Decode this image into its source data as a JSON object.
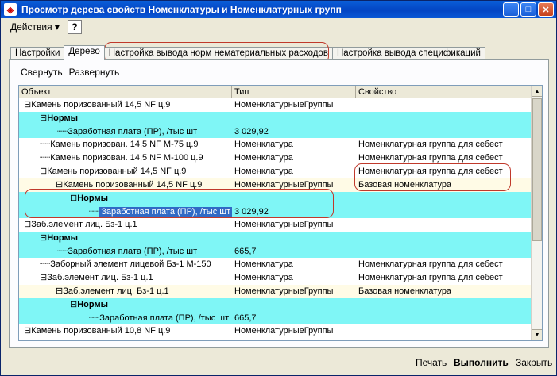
{
  "window": {
    "title": "Просмотр дерева свойств Номенклатуры и Номенклатурных групп",
    "icon": "app-icon"
  },
  "menubar": {
    "actions_label": "Действия ▾",
    "help_label": "?"
  },
  "tabs": [
    "Настройки",
    "Дерево",
    "Настройка вывода норм нематериальных расходов",
    "Настройка вывода спецификаций"
  ],
  "toolbar": {
    "collapse_label": "Свернуть",
    "expand_label": "Развернуть"
  },
  "table": {
    "columns": [
      "Объект",
      "Тип",
      "Свойство"
    ],
    "rows": [
      {
        "object": "Камень поризованный 14,5  NF ц.9",
        "type": "НоменклатурныеГруппы",
        "property": ""
      },
      {
        "object": "Нормы",
        "type": "",
        "property": ""
      },
      {
        "object": "Заработная плата (ПР), /тыс шт",
        "type": "3 029,92",
        "property": ""
      },
      {
        "object": "Камень поризован. 14,5 NF М-75 ц.9",
        "type": "Номенклатура",
        "property": "Номенклатурная группа для себест"
      },
      {
        "object": "Камень поризован. 14,5 NF М-100 ц.9",
        "type": "Номенклатура",
        "property": "Номенклатурная группа для себест"
      },
      {
        "object": "Камень поризованный 14,5  NF ц.9",
        "type": "Номенклатура",
        "property": "Номенклатурная группа для себест"
      },
      {
        "object": "Камень поризованный 14,5  NF ц.9",
        "type": "НоменклатурныеГруппы",
        "property": "Базовая номенклатура"
      },
      {
        "object": "Нормы",
        "type": "",
        "property": ""
      },
      {
        "object": "Заработная плата (ПР), /тыс шт",
        "type": "3 029,92",
        "property": ""
      },
      {
        "object": "Заб.элемент лиц. Бз-1  ц.1",
        "type": "НоменклатурныеГруппы",
        "property": ""
      },
      {
        "object": "Нормы",
        "type": "",
        "property": ""
      },
      {
        "object": "Заработная плата (ПР), /тыс шт",
        "type": "665,7",
        "property": ""
      },
      {
        "object": "Заборный элемент лицевой Бз-1 М-150",
        "type": "Номенклатура",
        "property": "Номенклатурная группа для себест"
      },
      {
        "object": "Заб.элемент лиц. Бз-1  ц.1",
        "type": "Номенклатура",
        "property": "Номенклатурная группа для себест"
      },
      {
        "object": "Заб.элемент лиц. Бз-1  ц.1",
        "type": "НоменклатурныеГруппы",
        "property": "Базовая номенклатура"
      },
      {
        "object": "Нормы",
        "type": "",
        "property": ""
      },
      {
        "object": "Заработная плата (ПР), /тыс шт",
        "type": "665,7",
        "property": ""
      },
      {
        "object": "Камень поризованный 10,8  NF ц.9",
        "type": "НоменклатурныеГруппы",
        "property": ""
      }
    ]
  },
  "footer": {
    "print_label": "Печать",
    "run_label": "Выполнить",
    "close_label": "Закрыть"
  },
  "colors": {
    "norm_row": "#7ff6f6",
    "selection": "#316ac5",
    "title_bar": "#0344c3",
    "highlight_ring": "#c0392b"
  }
}
